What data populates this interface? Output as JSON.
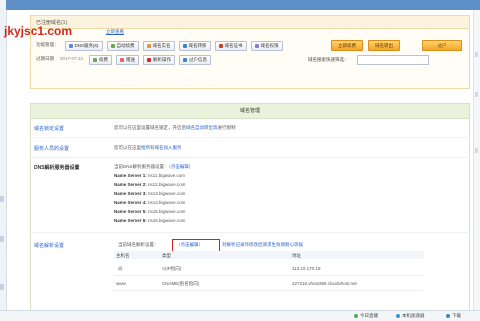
{
  "panel_header": "已注册域名(1)",
  "domain": {
    "name": "jkyjsc1.com",
    "link": "立即查看"
  },
  "row1": {
    "label": "功能管理：",
    "buttons": [
      "DNS服务(6)",
      "自动续费",
      "域名实名",
      "域名转移",
      "域名证书",
      "域名权限"
    ],
    "orange_buttons": [
      "立即续费",
      "域名转出",
      "过户"
    ]
  },
  "row2": {
    "label": "过期日期",
    "date": "2017-07-22",
    "buttons": [
      "续费",
      "赠送",
      "解析操作",
      "过户信息"
    ]
  },
  "search": {
    "label": "域名搜索快速筛选：",
    "value": ""
  },
  "section": {
    "title": "域名管理",
    "rows": [
      {
        "label": "域名锁定设置",
        "text_pre": "您可以在这里设置域名锁定，开启后",
        "text_link": "域名自动转出等",
        "text_post": "进行限制"
      },
      {
        "label": "服务人员的设置",
        "text_pre": "您可以在这里",
        "text_link": "给所有域名加入服务",
        "text_post": ""
      }
    ],
    "dns": {
      "label": "DNS解析服务器设置",
      "intro": "当前DNS解析服务器设置：",
      "edit": "（点击编辑）",
      "servers": [
        {
          "name": "Name Server 1:",
          "value": "ns11.bigwave.com"
        },
        {
          "name": "Name Server 2:",
          "value": "ns12.bigwave.com"
        },
        {
          "name": "Name Server 3:",
          "value": "ns13.bigwave.com"
        },
        {
          "name": "Name Server 4:",
          "value": "ns14.bigwave.com"
        },
        {
          "name": "Name Server 5:",
          "value": "ns15.bigwave.com"
        },
        {
          "name": "Name Server 6:",
          "value": "ns16.bigwave.com"
        }
      ]
    },
    "resolve": {
      "label": "域名解析设置",
      "intro": "当前域名解析设置：",
      "edit": "（点击编辑）",
      "tip": "对解析记录作修改后请求生效请耐心等候",
      "columns": [
        "主机名",
        "类型",
        "地址"
      ],
      "records": [
        {
          "host": "@",
          "type": "A(IP指向)",
          "address": "113.10.170.19"
        },
        {
          "host": "www",
          "type": "CNAME(别名指向)",
          "address": "227216.vhost396.cloudvhost.net"
        }
      ]
    }
  },
  "statusbar": {
    "items": [
      "今日直播",
      "本机加速器",
      "下载"
    ]
  },
  "colors": {
    "accent_blue": "#2a62c9",
    "domain_red": "#d12a1c",
    "highlight_red": "#d1221b",
    "orange_button": "#f4a52b",
    "section_header": "#e9f2db"
  }
}
